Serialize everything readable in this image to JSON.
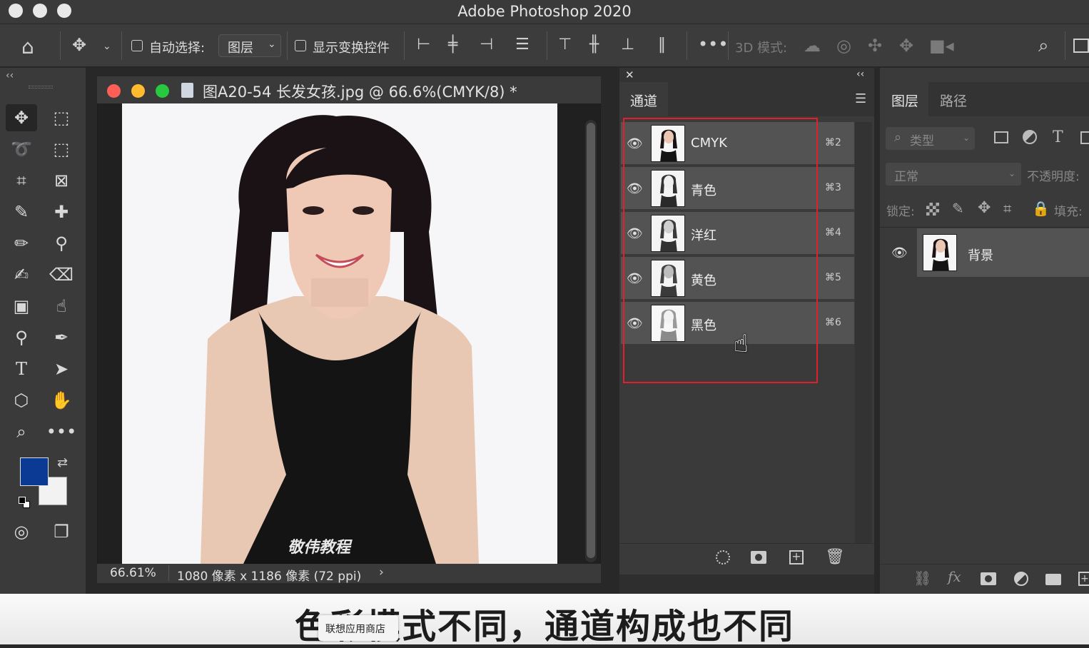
{
  "app": {
    "title": "Adobe Photoshop 2020"
  },
  "options": {
    "auto_select_label": "自动选择:",
    "auto_select_value": "图层",
    "show_transform_label": "显示变换控件",
    "mode_3d_label": "3D 模式:"
  },
  "document": {
    "tab_title": "图A20-54 长发女孩.jpg @ 66.6%(CMYK/8) *",
    "zoom": "66.61%",
    "info": "1080 像素 x 1186 像素 (72 ppi)",
    "watermark": "敬伟教程"
  },
  "channels": {
    "tab": "通道",
    "rows": [
      {
        "name": "CMYK",
        "shortcut": "⌘2"
      },
      {
        "name": "青色",
        "shortcut": "⌘3"
      },
      {
        "name": "洋红",
        "shortcut": "⌘4"
      },
      {
        "name": "黄色",
        "shortcut": "⌘5"
      },
      {
        "name": "黑色",
        "shortcut": "⌘6"
      }
    ]
  },
  "layers": {
    "tab_layers": "图层",
    "tab_paths": "路径",
    "filter_placeholder": "类型",
    "blend_mode": "正常",
    "opacity_label": "不透明度:",
    "lock_label": "锁定:",
    "fill_label": "填充:",
    "rows": [
      {
        "name": "背景"
      }
    ]
  },
  "colors": {
    "foreground": "#0b3a94",
    "background": "#f2f2f2",
    "highlight": "#e0202a"
  },
  "overlay": {
    "store_badge": "联想应用商店",
    "caption": "色彩模式不同，通道构成也不同"
  }
}
